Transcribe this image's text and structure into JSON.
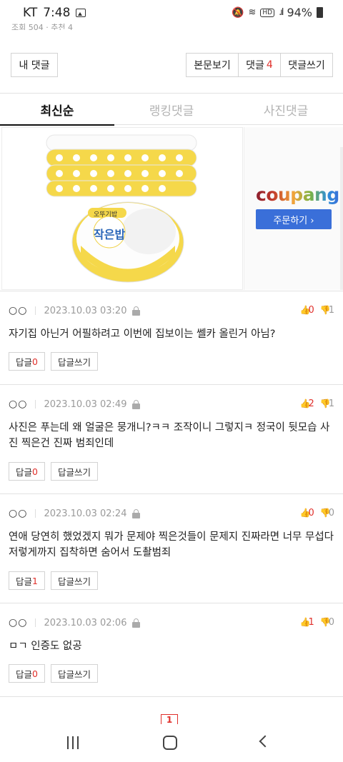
{
  "status_bar": {
    "carrier": "KT",
    "time": "7:48",
    "hd_label": "HD",
    "battery": "94%"
  },
  "top_strip": {
    "text": "조회 504 · 추천 4"
  },
  "toolbar": {
    "my_comments": "내 댓글",
    "view_post": "본문보기",
    "comments_label": "댓글",
    "comments_count": "4",
    "write_comment": "댓글쓰기"
  },
  "tabs": [
    {
      "label": "최신순",
      "active": true
    },
    {
      "label": "랭킹댓글",
      "active": false
    },
    {
      "label": "사진댓글",
      "active": false
    }
  ],
  "ad": {
    "product_brand": "오뚜기밥",
    "product_name": "작은밥",
    "logo_text": "coupang",
    "order_label": "주문하기 ›"
  },
  "comments": [
    {
      "author": "○○",
      "date": "2023.10.03 03:20",
      "up": "0",
      "down": "1",
      "body": "자기집 아닌거 어필하려고 이번에 집보이는 쎌카 올린거 아님?",
      "reply_label": "답글",
      "reply_count": "0",
      "write_reply": "답글쓰기"
    },
    {
      "author": "○○",
      "date": "2023.10.03 02:49",
      "up": "2",
      "down": "1",
      "body": "사진은 푸는데 왜 얼굴은 뭉개니?ㅋㅋ 조작이니 그렇지ㅋ 정국이 뒷모습 사진 찍은건 진짜 범죄인데",
      "reply_label": "답글",
      "reply_count": "0",
      "write_reply": "답글쓰기"
    },
    {
      "author": "○○",
      "date": "2023.10.03 02:24",
      "up": "0",
      "down": "0",
      "body": "연애 당연히 했었겠지 뭐가 문제야 찍은것들이 문제지 진짜라면 너무 무섭다 저렇게까지 집착하면 숨어서 도촬범죄",
      "reply_label": "답글",
      "reply_count": "1",
      "write_reply": "답글쓰기"
    },
    {
      "author": "○○",
      "date": "2023.10.03 02:06",
      "up": "1",
      "down": "0",
      "body": "ㅁㄱ 인증도 없공",
      "reply_label": "답글",
      "reply_count": "0",
      "write_reply": "답글쓰기"
    }
  ],
  "pagination": {
    "current": "1"
  },
  "colors": {
    "accent_red": "#e0302b",
    "coupang_blue": "#3a6fd9"
  }
}
